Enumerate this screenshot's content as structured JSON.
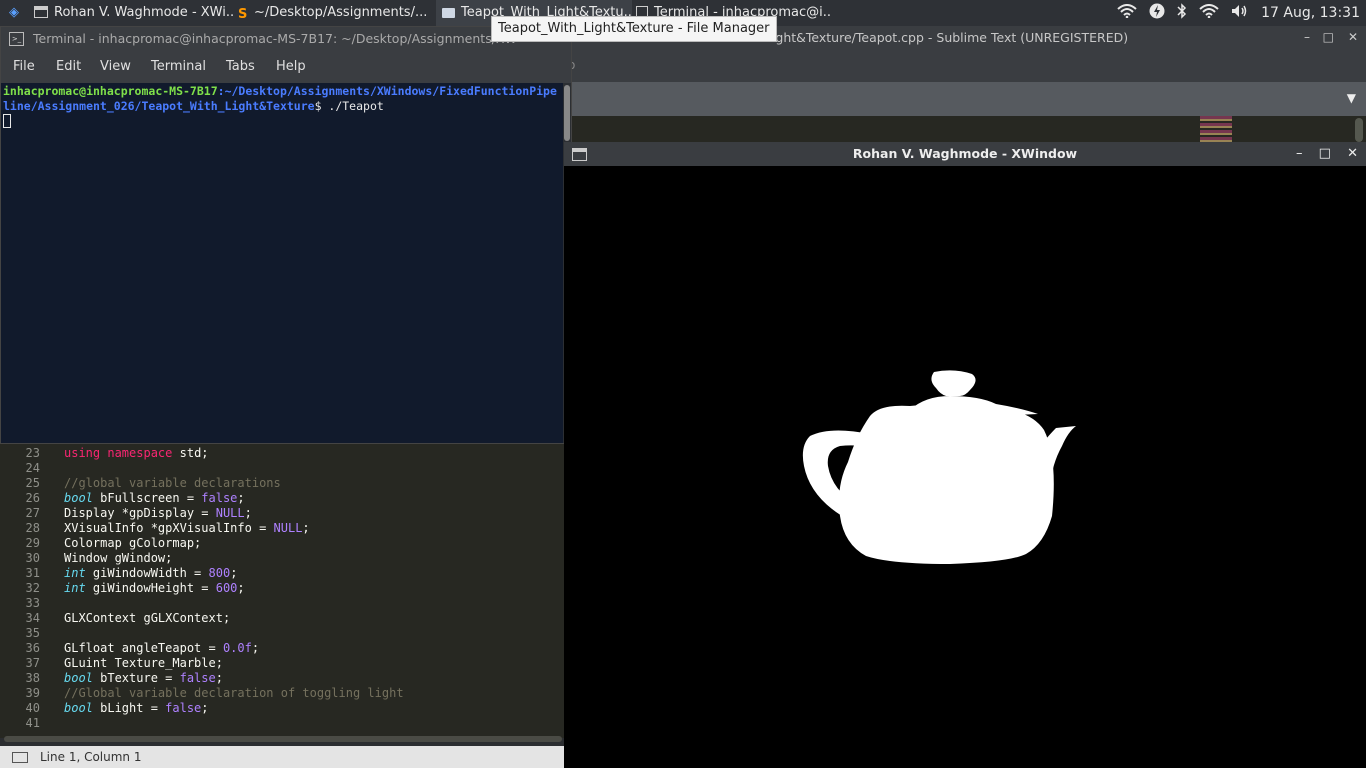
{
  "panel": {
    "tasks": [
      {
        "label": "Rohan V. Waghmode - XWi...",
        "icon": "window-icon"
      },
      {
        "label": "~/Desktop/Assignments/...",
        "icon": "sublime-icon"
      },
      {
        "label": "Teapot_With_Light&Textu...",
        "icon": "folder-icon"
      },
      {
        "label": "Terminal - inhacpromac@i...",
        "icon": "terminal-icon"
      }
    ],
    "clock": "17 Aug, 13:31"
  },
  "tooltip": "Teapot_With_Light&Texture - File Manager",
  "sublime": {
    "title": "...ight&Texture/Teapot.cpp - Sublime Text (UNREGISTERED)",
    "menu_fragment": "o",
    "status": "Line 1, Column 1",
    "code_lines": [
      {
        "n": "23",
        "html": "<span class=\"kw\">using</span> <span class=\"kw\">namespace</span> std;"
      },
      {
        "n": "24",
        "html": ""
      },
      {
        "n": "25",
        "html": "<span class=\"cm\">//global variable declarations</span>"
      },
      {
        "n": "26",
        "html": "<span class=\"ty\">bool</span> bFullscreen = <span class=\"nu\">false</span>;"
      },
      {
        "n": "27",
        "html": "Display *gpDisplay = <span class=\"nu\">NULL</span>;"
      },
      {
        "n": "28",
        "html": "XVisualInfo *gpXVisualInfo = <span class=\"nu\">NULL</span>;"
      },
      {
        "n": "29",
        "html": "Colormap gColormap;"
      },
      {
        "n": "30",
        "html": "Window gWindow;"
      },
      {
        "n": "31",
        "html": "<span class=\"ty\">int</span> giWindowWidth = <span class=\"nu\">800</span>;"
      },
      {
        "n": "32",
        "html": "<span class=\"ty\">int</span> giWindowHeight = <span class=\"nu\">600</span>;"
      },
      {
        "n": "33",
        "html": ""
      },
      {
        "n": "34",
        "html": "GLXContext gGLXContext;"
      },
      {
        "n": "35",
        "html": ""
      },
      {
        "n": "36",
        "html": "GLfloat angleTeapot = <span class=\"nu\">0.0f</span>;"
      },
      {
        "n": "37",
        "html": "GLuint Texture_Marble;"
      },
      {
        "n": "38",
        "html": "<span class=\"ty\">bool</span> bTexture = <span class=\"nu\">false</span>;"
      },
      {
        "n": "39",
        "html": "<span class=\"cm\">//Global variable declaration of toggling light</span>"
      },
      {
        "n": "40",
        "html": "<span class=\"ty\">bool</span> bLight = <span class=\"nu\">false</span>;"
      },
      {
        "n": "41",
        "html": ""
      }
    ]
  },
  "terminal": {
    "title": "Terminal - inhacpromac@inhacpromac-MS-7B17: ~/Desktop/Assignments/XW",
    "menu": [
      "File",
      "Edit",
      "View",
      "Terminal",
      "Tabs",
      "Help"
    ],
    "prompt_user": "inhacpromac@inhacpromac-MS-7B17",
    "prompt_path_1": ":~/Desktop/Assignments/XWindows/FixedFunctionPipe",
    "prompt_path_2": "line/Assignment_026/Teapot_With_Light&Texture",
    "prompt_cmd": "$ ./Teapot"
  },
  "xwindow": {
    "title": "Rohan V. Waghmode - XWindow",
    "buttons": {
      "minimize": "–",
      "maximize": "□",
      "close": "✕"
    }
  },
  "icons": {
    "wifi": "📶",
    "power": "⚡",
    "bluetooth": "ᛒ",
    "volume": "🔊"
  }
}
